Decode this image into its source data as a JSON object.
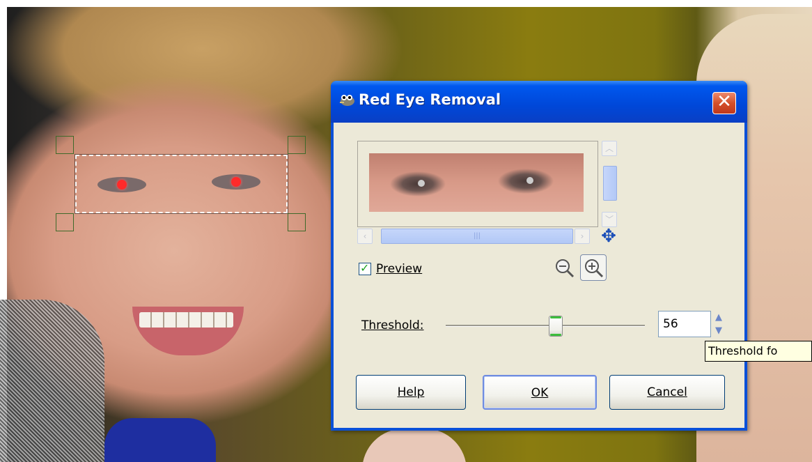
{
  "dialog": {
    "title": "Red Eye Removal",
    "close_icon": "close-icon",
    "app_icon": "gimp-wilber-icon",
    "preview": {
      "label": "Preview",
      "checked": true
    },
    "zoom_out_icon": "zoom-out-icon",
    "zoom_in_icon": "zoom-in-icon",
    "navigate_icon": "move-arrows-icon",
    "threshold": {
      "label": "Threshold:",
      "value": "56",
      "slider_fraction": 0.56
    },
    "buttons": {
      "help": "Help",
      "ok": "OK",
      "cancel": "Cancel"
    }
  },
  "tooltip": {
    "text": "Threshold fo"
  },
  "colors": {
    "titlebar": "#0047d8",
    "dialog_bg": "#ece9d8",
    "close_red": "#d4502a",
    "check_green": "#21a121"
  }
}
